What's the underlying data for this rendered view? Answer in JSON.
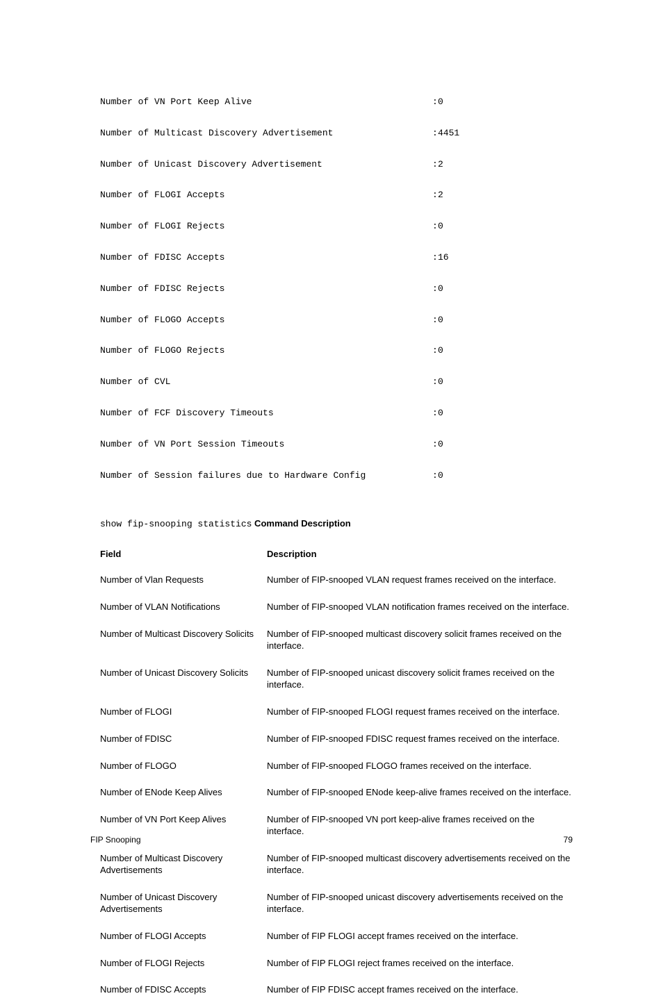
{
  "stats": [
    {
      "label": "Number of VN Port Keep Alive",
      "value": "0"
    },
    {
      "label": "Number of Multicast Discovery Advertisement",
      "value": "4451"
    },
    {
      "label": "Number of Unicast Discovery Advertisement",
      "value": "2"
    },
    {
      "label": "Number of FLOGI Accepts",
      "value": "2"
    },
    {
      "label": "Number of FLOGI Rejects",
      "value": "0"
    },
    {
      "label": "Number of FDISC Accepts",
      "value": "16"
    },
    {
      "label": "Number of FDISC Rejects",
      "value": "0"
    },
    {
      "label": "Number of FLOGO Accepts",
      "value": "0"
    },
    {
      "label": "Number of FLOGO Rejects",
      "value": "0"
    },
    {
      "label": "Number of CVL",
      "value": "0"
    },
    {
      "label": "Number of FCF Discovery Timeouts",
      "value": "0"
    },
    {
      "label": "Number of VN Port Session Timeouts",
      "value": "0"
    },
    {
      "label": "Number of Session failures due to Hardware Config",
      "value": "0"
    }
  ],
  "caption_mono": "show fip-snooping statistics",
  "caption_bold": " Command Description",
  "header_field": "Field",
  "header_desc": "Description",
  "rows": [
    {
      "field": "Number of Vlan Requests",
      "desc": "Number of FIP-snooped VLAN request frames received on the interface."
    },
    {
      "field": "Number of VLAN Notifications",
      "desc": "Number of FIP-snooped VLAN notification frames received on the interface."
    },
    {
      "field": "Number of Multicast Discovery Solicits",
      "desc": "Number of FIP-snooped multicast discovery solicit frames received on the interface."
    },
    {
      "field": "Number of Unicast Discovery Solicits",
      "desc": "Number of FIP-snooped unicast discovery solicit frames received on the interface."
    },
    {
      "field": "Number of FLOGI",
      "desc": "Number of FIP-snooped FLOGI request frames received on the interface."
    },
    {
      "field": "Number of FDISC",
      "desc": "Number of FIP-snooped FDISC request frames received on the interface."
    },
    {
      "field": "Number of FLOGO",
      "desc": "Number of FIP-snooped FLOGO frames received on the interface."
    },
    {
      "field": "Number of ENode Keep Alives",
      "desc": "Number of FIP-snooped ENode keep-alive frames received on the interface."
    },
    {
      "field": "Number of VN Port Keep Alives",
      "desc": "Number of FIP-snooped VN port keep-alive frames received on the interface."
    },
    {
      "field": "Number of Multicast Discovery Advertisements",
      "desc": "Number of FIP-snooped multicast discovery advertisements received on the interface."
    },
    {
      "field": "Number of Unicast Discovery Advertisements",
      "desc": "Number of FIP-snooped unicast discovery advertisements received on the interface."
    },
    {
      "field": "Number of FLOGI Accepts",
      "desc": "Number of FIP FLOGI accept frames received on the interface."
    },
    {
      "field": "Number of FLOGI Rejects",
      "desc": "Number of FIP FLOGI reject frames received on the interface."
    },
    {
      "field": "Number of FDISC Accepts",
      "desc": "Number of FIP FDISC accept frames received on the interface."
    }
  ],
  "footer_left": "FIP Snooping",
  "footer_right": "79"
}
